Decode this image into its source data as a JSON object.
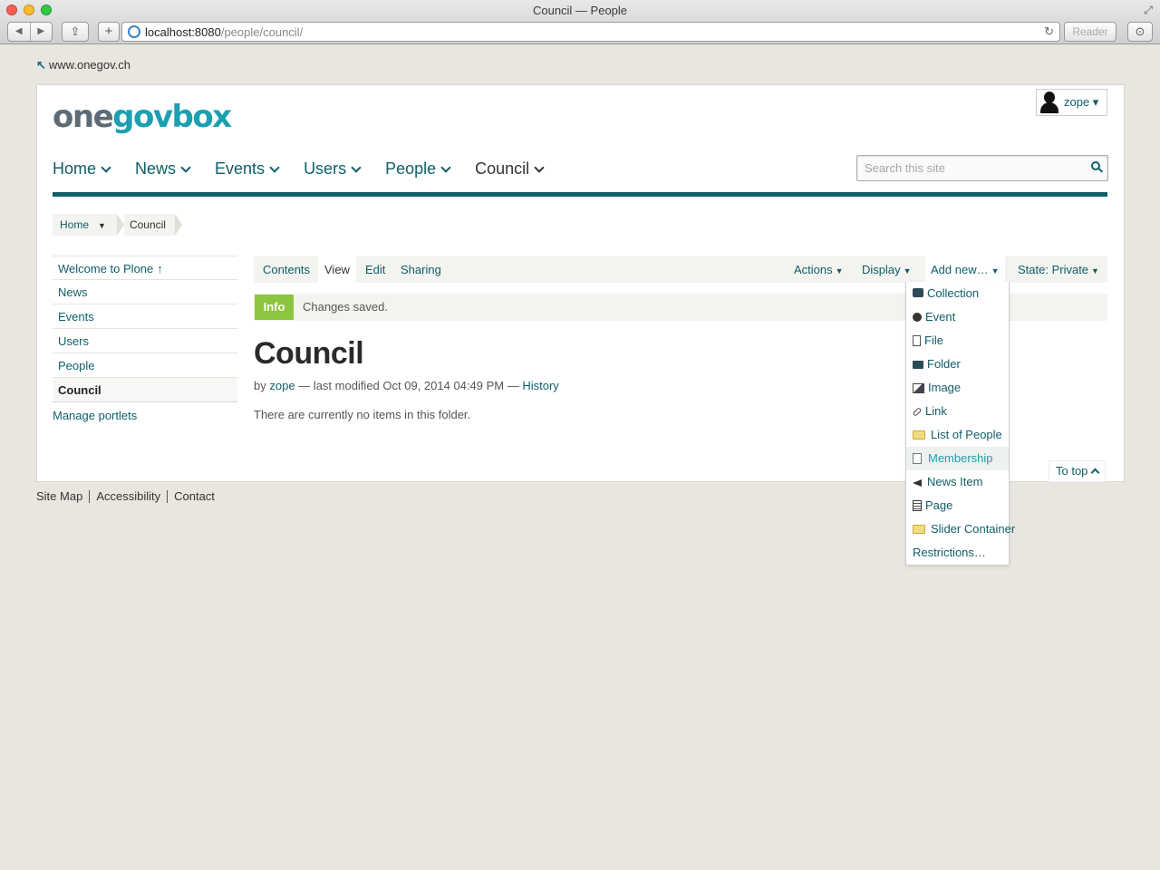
{
  "window": {
    "title": "Council — People",
    "url_host": "localhost:8080",
    "url_path": "/people/council/",
    "reader_label": "Reader"
  },
  "site": {
    "back_link": "www.onegov.ch",
    "logo": {
      "part1": "one",
      "part2": "gov",
      "part3": "box"
    },
    "user": "zope ▾"
  },
  "nav": {
    "items": [
      {
        "label": "Home"
      },
      {
        "label": "News"
      },
      {
        "label": "Events"
      },
      {
        "label": "Users"
      },
      {
        "label": "People"
      },
      {
        "label": "Council"
      }
    ],
    "current": "Council"
  },
  "search": {
    "placeholder": "Search this site"
  },
  "breadcrumb": {
    "home": "Home",
    "current": "Council"
  },
  "portlet": {
    "items": [
      {
        "label": "Welcome to Plone"
      },
      {
        "label": "News"
      },
      {
        "label": "Events"
      },
      {
        "label": "Users"
      },
      {
        "label": "People"
      },
      {
        "label": "Council"
      }
    ],
    "current": "Council",
    "manage": "Manage portlets"
  },
  "editbar": {
    "tabs": [
      {
        "label": "Contents"
      },
      {
        "label": "View"
      },
      {
        "label": "Edit"
      },
      {
        "label": "Sharing"
      }
    ],
    "active_tab": "View",
    "actions": "Actions",
    "display": "Display",
    "add_new": "Add new…",
    "state": "State: Private"
  },
  "status": {
    "badge": "Info",
    "text": "Changes saved."
  },
  "content": {
    "title": "Council",
    "by": "by",
    "author": "zope",
    "modified": "— last modified Oct 09, 2014 04:49 PM —",
    "history": "History",
    "empty": "There are currently no items in this folder."
  },
  "add_menu": {
    "items": [
      {
        "label": "Collection",
        "icon": "collection-icon"
      },
      {
        "label": "Event",
        "icon": "event-icon"
      },
      {
        "label": "File",
        "icon": "file-icon"
      },
      {
        "label": "Folder",
        "icon": "folder-icon"
      },
      {
        "label": "Image",
        "icon": "image-icon"
      },
      {
        "label": "Link",
        "icon": "link-icon"
      },
      {
        "label": "List of People",
        "icon": "folder-yellow-icon"
      },
      {
        "label": "Membership",
        "icon": "document-icon"
      },
      {
        "label": "News Item",
        "icon": "news-icon"
      },
      {
        "label": "Page",
        "icon": "page-icon"
      },
      {
        "label": "Slider Container",
        "icon": "folder-yellow-icon"
      },
      {
        "label": "Restrictions…",
        "icon": ""
      }
    ],
    "hovered": "Membership"
  },
  "to_top": "To top",
  "footer": {
    "links": [
      {
        "label": "Site Map"
      },
      {
        "label": "Accessibility"
      },
      {
        "label": "Contact"
      }
    ]
  },
  "colors": {
    "brand": "#0f5e68",
    "accent": "#1aa0b0",
    "info_badge": "#8cc63f"
  }
}
